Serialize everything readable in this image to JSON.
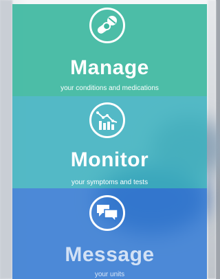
{
  "manage": {
    "title": "Manage",
    "subtitle": "your conditions and medications",
    "icon": "pills-icon"
  },
  "monitor": {
    "title": "Monitor",
    "subtitle": "your symptoms and tests",
    "icon": "chart-icon"
  },
  "message": {
    "title": "Message",
    "subtitle": "your units",
    "icon": "chat-bubbles-icon"
  },
  "colors": {
    "manage": "#3eb8a0",
    "monitor": "#3cb0be",
    "message": "#347ad2"
  }
}
